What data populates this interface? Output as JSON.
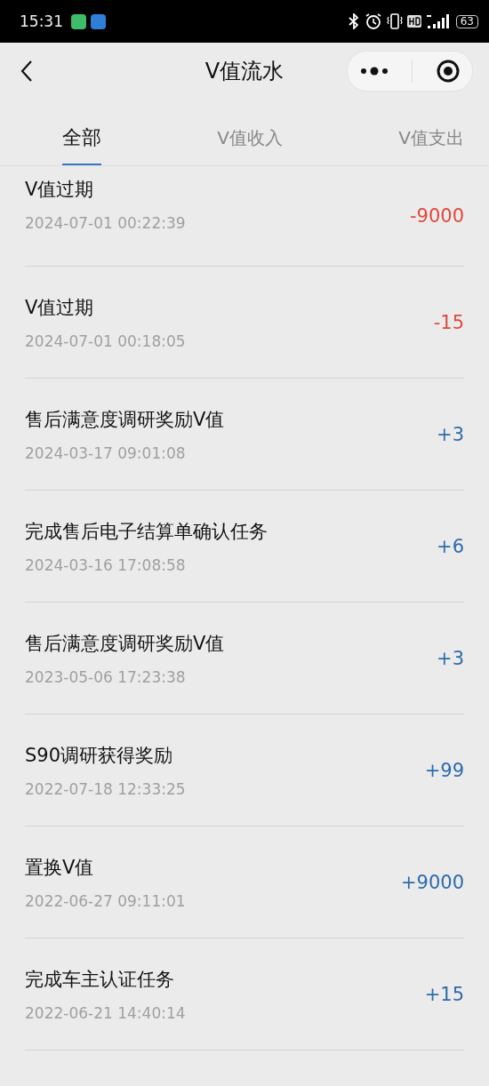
{
  "status_bar": {
    "time": "15:31",
    "battery": "63"
  },
  "header": {
    "title": "V值流水"
  },
  "tabs": [
    {
      "label": "全部",
      "selected": true
    },
    {
      "label": "V值收入",
      "selected": false
    },
    {
      "label": "V值支出",
      "selected": false
    }
  ],
  "records": [
    {
      "title": "V值过期",
      "time": "2024-07-01 00:22:39",
      "amount": "-9000",
      "kind": "expense"
    },
    {
      "title": "V值过期",
      "time": "2024-07-01 00:18:05",
      "amount": "-15",
      "kind": "expense"
    },
    {
      "title": "售后满意度调研奖励V值",
      "time": "2024-03-17 09:01:08",
      "amount": "+3",
      "kind": "income"
    },
    {
      "title": "完成售后电子结算单确认任务",
      "time": "2024-03-16 17:08:58",
      "amount": "+6",
      "kind": "income"
    },
    {
      "title": "售后满意度调研奖励V值",
      "time": "2023-05-06 17:23:38",
      "amount": "+3",
      "kind": "income"
    },
    {
      "title": "S90调研获得奖励",
      "time": "2022-07-18 12:33:25",
      "amount": "+99",
      "kind": "income"
    },
    {
      "title": "置换V值",
      "time": "2022-06-27 09:11:01",
      "amount": "+9000",
      "kind": "income"
    },
    {
      "title": "完成车主认证任务",
      "time": "2022-06-21 14:40:14",
      "amount": "+15",
      "kind": "income"
    }
  ]
}
